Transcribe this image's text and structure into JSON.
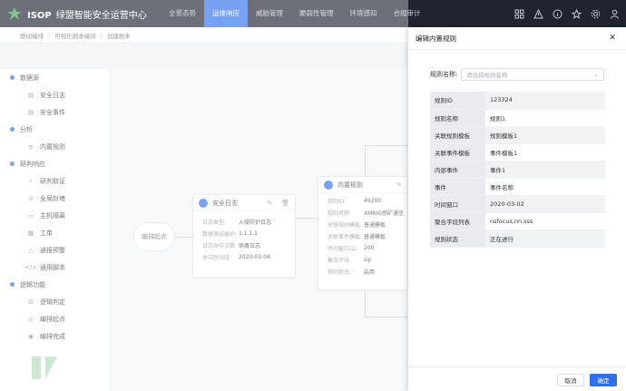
{
  "app": {
    "brand": "ISOP",
    "title": "绿盟智能安全运营中心"
  },
  "nav": [
    "全景态势",
    "运维响应",
    "威胁管理",
    "脆弱性管理",
    "环境感知",
    "合规审计"
  ],
  "nav_active_index": 1,
  "breadcrumb": [
    "联动编排",
    "可视化剧本编排",
    "创建剧本"
  ],
  "sidebar": {
    "groups": [
      {
        "label": "数据源",
        "items": [
          {
            "label": "安全日志",
            "icon": "doc-icon"
          },
          {
            "label": "安全事件",
            "icon": "doc-icon"
          }
        ]
      },
      {
        "label": "分析",
        "items": [
          {
            "label": "内置规则",
            "icon": "rule-icon"
          }
        ]
      },
      {
        "label": "研判响应",
        "items": [
          {
            "label": "研判取证",
            "icon": "search-icon"
          },
          {
            "label": "全局封堵",
            "icon": "block-icon"
          },
          {
            "label": "主机隔离",
            "icon": "host-icon"
          },
          {
            "label": "工单",
            "icon": "ticket-icon"
          },
          {
            "label": "通报预警",
            "icon": "alert-icon"
          },
          {
            "label": "通用脚本",
            "icon": "script-icon"
          }
        ]
      },
      {
        "label": "逻辑功能",
        "items": [
          {
            "label": "逻辑判定",
            "icon": "logic-icon"
          },
          {
            "label": "编排起点",
            "icon": "start-icon"
          },
          {
            "label": "编排完成",
            "icon": "finish-icon"
          }
        ]
      }
    ]
  },
  "canvas": {
    "start_node": "编排起点",
    "log_card": {
      "title": "安全日志",
      "rows": [
        {
          "k": "日志类型:",
          "v": "入侵防护日志"
        },
        {
          "k": "数据源设备IP:",
          "v": "1.1.1.1"
        },
        {
          "k": "日志命中次数:",
          "v": "病毒日志"
        },
        {
          "k": "命中时间段:",
          "v": "2020-03-04"
        }
      ]
    },
    "rule_card": {
      "title": "内置规则",
      "rows": [
        {
          "k": "规则ID:",
          "v": "49200"
        },
        {
          "k": "规则名称:",
          "v": "XMRIG挖矿通信"
        },
        {
          "k": "关联规则模板:",
          "v": "普通模板"
        },
        {
          "k": "关联事件模板:",
          "v": "普通模板"
        },
        {
          "k": "时间窗口(s):",
          "v": "200"
        },
        {
          "k": "聚合字段:",
          "v": "sip"
        },
        {
          "k": "规则状态:",
          "v": "启用"
        }
      ]
    }
  },
  "drawer": {
    "title": "编辑内置规则",
    "field_label": "规则名称:",
    "select_placeholder": "请选择规则名称",
    "rows": [
      {
        "k": "规则ID",
        "v": "123324"
      },
      {
        "k": "规则名称",
        "v": "规则1"
      },
      {
        "k": "关联规则模板",
        "v": "规则模板1"
      },
      {
        "k": "关联事件模板",
        "v": "事件模板1"
      },
      {
        "k": "内部事件",
        "v": "事件1"
      },
      {
        "k": "事件",
        "v": "事件名称"
      },
      {
        "k": "时间窗口",
        "v": "2020-03-02"
      },
      {
        "k": "聚合字段列表",
        "v": "nsfocus.nn.sss"
      },
      {
        "k": "规则状态",
        "v": "正在进行"
      }
    ],
    "cancel": "取消",
    "ok": "确定"
  },
  "colors": {
    "accent": "#2f6fed",
    "topbar": "#1f2430",
    "brand_green": "#3aa655"
  }
}
